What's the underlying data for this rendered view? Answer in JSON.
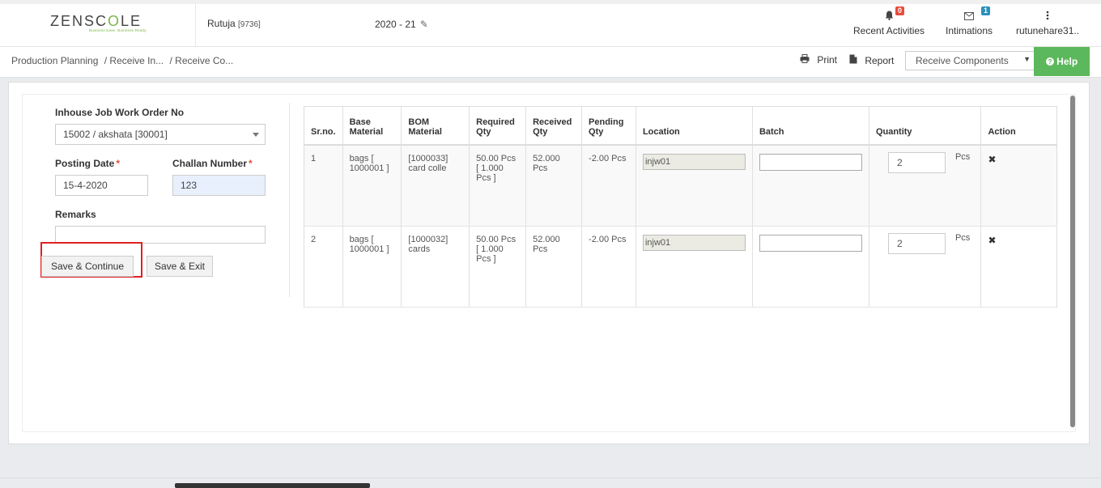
{
  "header": {
    "logo_left": "ZENSC",
    "logo_accent": "O",
    "logo_right": "LE",
    "logo_tag": "Business Ease. Business Ready.",
    "user_name": "Rutuja",
    "user_id": "[9736]",
    "year": "2020 - 21",
    "nav": [
      {
        "label": "Recent Activities",
        "badge": "0",
        "icon": "bell-icon"
      },
      {
        "label": "Intimations",
        "badge": "1",
        "icon": "envelope-icon"
      },
      {
        "label": "rutunehare31..",
        "icon": "kebab-icon"
      }
    ]
  },
  "breadcrumb": {
    "items": [
      "Production Planning",
      "/ Receive In...",
      "/ Receive Co..."
    ]
  },
  "toolbar": {
    "print_label": "Print",
    "report_label": "Report",
    "module_select": "Receive Components",
    "help_label": "Help"
  },
  "form": {
    "order_label": "Inhouse Job Work Order No",
    "order_value": "15002 / akshata [30001]",
    "posting_date_label": "Posting Date",
    "posting_date_value": "15-4-2020",
    "challan_label": "Challan Number",
    "challan_value": "123",
    "remarks_label": "Remarks",
    "remarks_value": "",
    "save_continue_label": "Save & Continue",
    "save_exit_label": "Save & Exit"
  },
  "table": {
    "columns": [
      "Sr.no.",
      "Base Material",
      "BOM Material",
      "Required Qty",
      "Received Qty",
      "Pending Qty",
      "Location",
      "Batch",
      "Quantity",
      "Action"
    ],
    "rows": [
      {
        "sr": "1",
        "base": "bags [ 1000001 ]",
        "bom": "[1000033] card colle",
        "required": "50.00 Pcs [ 1.000 Pcs ]",
        "received": "52.000 Pcs",
        "pending": "-2.00 Pcs",
        "location": "injw01",
        "batch": "",
        "quantity": "2",
        "unit": "Pcs",
        "action": "✖"
      },
      {
        "sr": "2",
        "base": "bags [ 1000001 ]",
        "bom": "[1000032] cards",
        "required": "50.00 Pcs [ 1.000 Pcs ]",
        "received": "52.000 Pcs",
        "pending": "-2.00 Pcs",
        "location": "injw01",
        "batch": "",
        "quantity": "2",
        "unit": "Pcs",
        "action": "✖"
      }
    ]
  }
}
